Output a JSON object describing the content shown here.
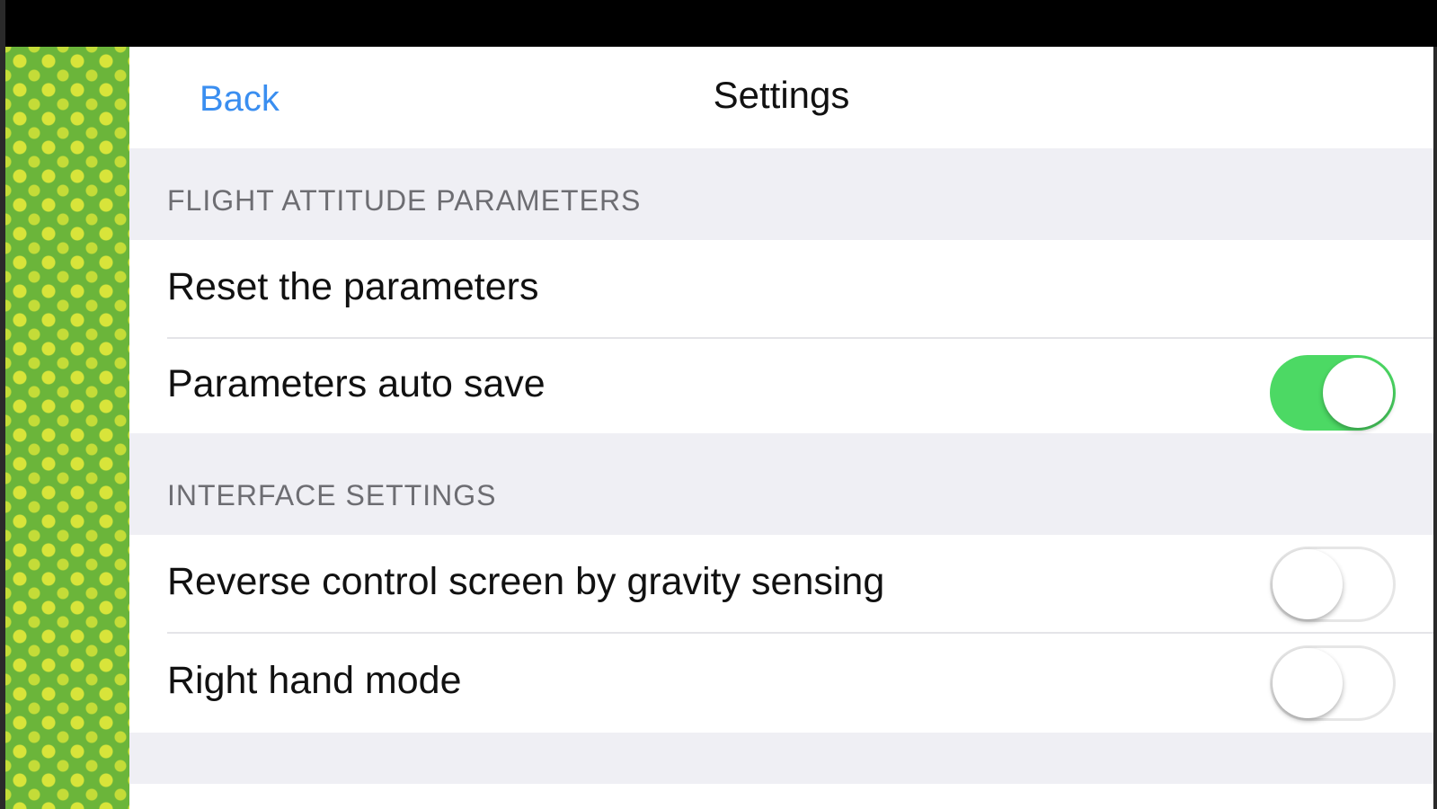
{
  "nav": {
    "back_label": "Back",
    "title": "Settings"
  },
  "sections": [
    {
      "header": "FLIGHT ATTITUDE PARAMETERS",
      "rows": [
        {
          "label": "Reset the parameters",
          "toggle": null
        },
        {
          "label": "Parameters auto save",
          "toggle": true
        }
      ]
    },
    {
      "header": "INTERFACE SETTINGS",
      "rows": [
        {
          "label": "Reverse control screen by gravity sensing",
          "toggle": false
        },
        {
          "label": "Right hand mode",
          "toggle": false
        }
      ]
    }
  ],
  "colors": {
    "accent": "#3a8ef0",
    "toggle_on": "#4cd964",
    "background": "#efeff4",
    "pattern_green": "#6bb53a",
    "pattern_yellow": "#d8e43a"
  }
}
